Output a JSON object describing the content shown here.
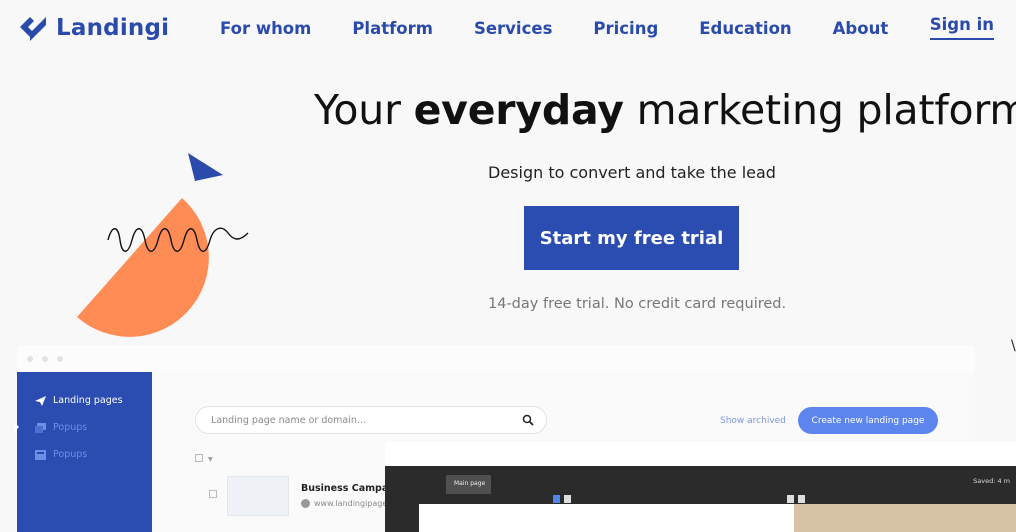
{
  "brand": {
    "name": "Landingi",
    "color": "#2a4bab"
  },
  "nav": {
    "items": [
      {
        "label": "For whom"
      },
      {
        "label": "Platform"
      },
      {
        "label": "Services"
      },
      {
        "label": "Pricing"
      },
      {
        "label": "Education"
      },
      {
        "label": "About"
      }
    ],
    "signin_label": "Sign in"
  },
  "hero": {
    "headline_before": "Your ",
    "headline_bold": "everyday",
    "headline_after": " marketing platform",
    "subline": "Design to convert and take the lead",
    "cta_label": "Start my free trial",
    "note": "14-day free trial. No credit card required."
  },
  "mockup": {
    "sidebar": [
      {
        "label": "Landing pages",
        "icon": "send-icon",
        "active": true
      },
      {
        "label": "Popups",
        "icon": "popup-icon",
        "active": false
      },
      {
        "label": "Popups",
        "icon": "grid-icon",
        "active": false
      }
    ],
    "search_placeholder": "Landing page name or domain...",
    "show_archived": "Show archived",
    "create_button": "Create new landing page",
    "row": {
      "title": "Business Campaign",
      "url": "www.landingipage.c"
    },
    "editor": {
      "tab": "Main page",
      "saved": "Saved: 4 m"
    }
  },
  "colors": {
    "primary": "#2b4cb0",
    "accent_orange": "#ff8c55",
    "create_button": "#5c85ee"
  }
}
